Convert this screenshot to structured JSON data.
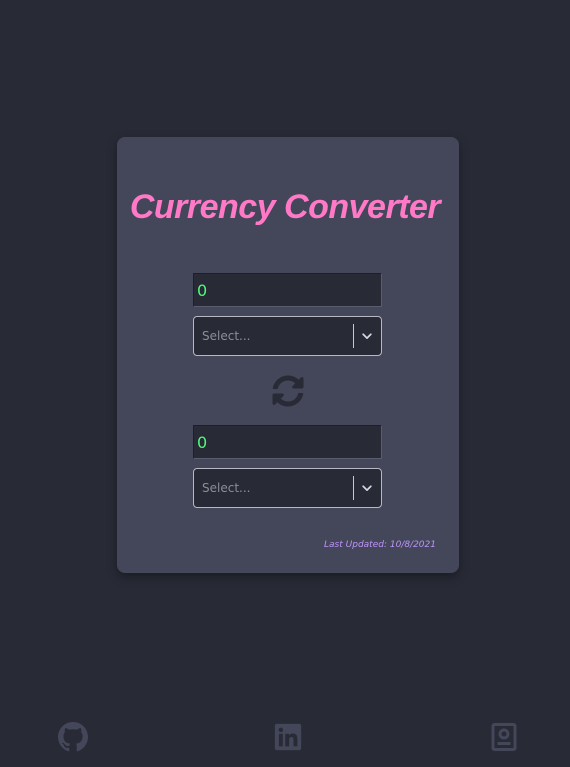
{
  "header": {
    "title": "Currency Converter"
  },
  "from": {
    "amount": "0",
    "currency_placeholder": "Select..."
  },
  "to": {
    "amount": "0",
    "currency_placeholder": "Select..."
  },
  "footer": {
    "last_updated": "Last Updated: 10/8/2021",
    "links": [
      {
        "icon": "github-icon"
      },
      {
        "icon": "linkedin-icon"
      },
      {
        "icon": "portfolio-icon"
      }
    ]
  },
  "colors": {
    "background": "#282a36",
    "card": "#44475a",
    "title": "#ff79c6",
    "amount_text": "#50fa7b",
    "updated_text": "#bd93f9",
    "icons": "#44475a"
  }
}
